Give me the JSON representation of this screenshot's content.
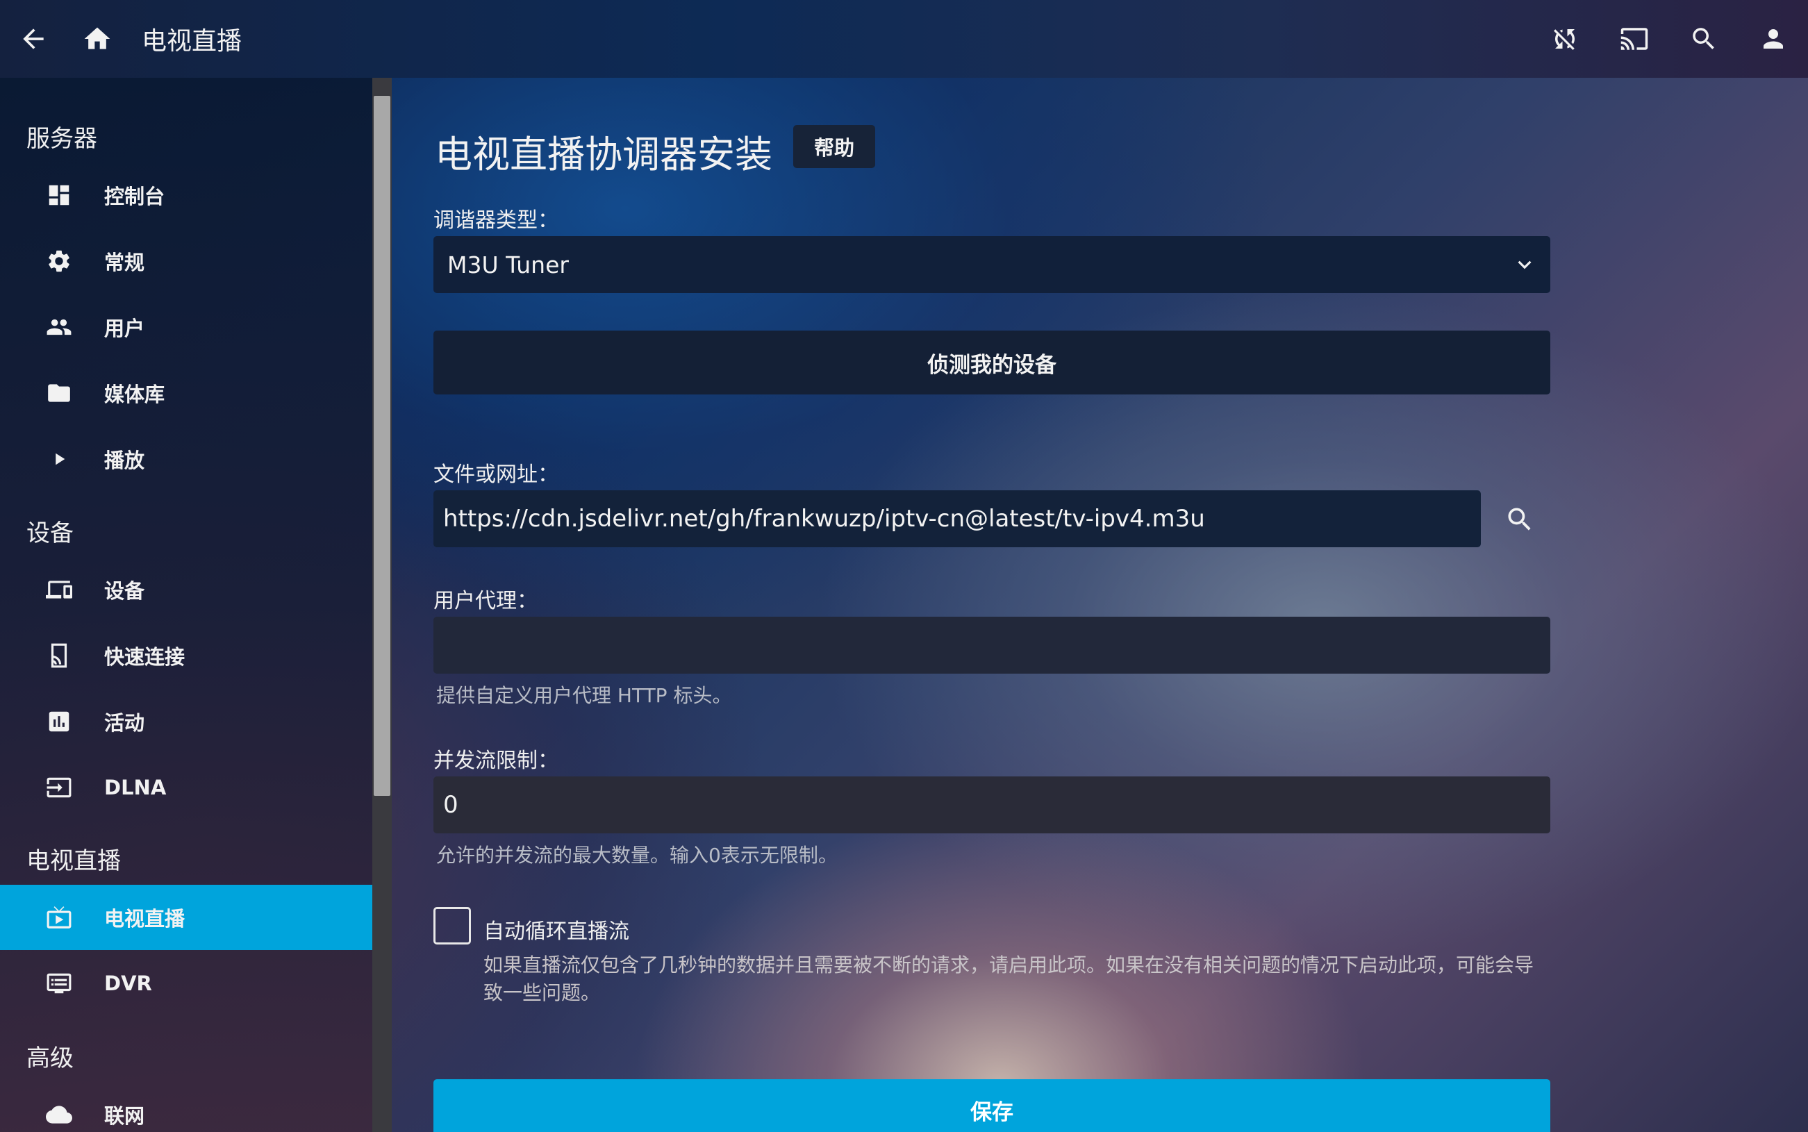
{
  "header": {
    "title": "电视直播",
    "back_icon": "arrow-back-icon",
    "home_icon": "home-icon",
    "right_icons": [
      "sync-disabled-icon",
      "cast-icon",
      "search-icon",
      "user-icon"
    ]
  },
  "sidebar": {
    "sections": [
      {
        "title": "服务器",
        "items": [
          {
            "label": "控制台",
            "icon": "dashboard-icon"
          },
          {
            "label": "常规",
            "icon": "gear-icon"
          },
          {
            "label": "用户",
            "icon": "users-icon"
          },
          {
            "label": "媒体库",
            "icon": "folder-icon"
          },
          {
            "label": "播放",
            "icon": "play-icon"
          }
        ]
      },
      {
        "title": "设备",
        "items": [
          {
            "label": "设备",
            "icon": "devices-icon"
          },
          {
            "label": "快速连接",
            "icon": "quick-connect-icon"
          },
          {
            "label": "活动",
            "icon": "activity-icon"
          },
          {
            "label": "DLNA",
            "icon": "dlna-icon"
          }
        ]
      },
      {
        "title": "电视直播",
        "items": [
          {
            "label": "电视直播",
            "icon": "live-tv-icon",
            "active": true
          },
          {
            "label": "DVR",
            "icon": "dvr-icon"
          }
        ]
      },
      {
        "title": "高级",
        "items": [
          {
            "label": "联网",
            "icon": "cloud-icon"
          }
        ]
      }
    ]
  },
  "main": {
    "title": "电视直播协调器安装",
    "help_label": "帮助",
    "tuner_type_label": "调谐器类型：",
    "tuner_type_value": "M3U Tuner",
    "detect_button": "侦测我的设备",
    "file_url_label": "文件或网址：",
    "file_url_value": "https://cdn.jsdelivr.net/gh/frankwuzp/iptv-cn@latest/tv-ipv4.m3u",
    "user_agent_label": "用户代理：",
    "user_agent_value": "",
    "user_agent_hint": "提供自定义用户代理 HTTP 标头。",
    "stream_limit_label": "并发流限制：",
    "stream_limit_value": "0",
    "stream_limit_hint": "允许的并发流的最大数量。输入0表示无限制。",
    "auto_loop_label": "自动循环直播流",
    "auto_loop_checked": false,
    "auto_loop_hint": "如果直播流仅包含了几秒钟的数据并且需要被不断的请求，请启用此项。如果在没有相关问题的情况下启动此项，可能会导致一些问题。",
    "save_button": "保存"
  },
  "colors": {
    "accent": "#00a4dc",
    "input_dark": "#13223a"
  }
}
